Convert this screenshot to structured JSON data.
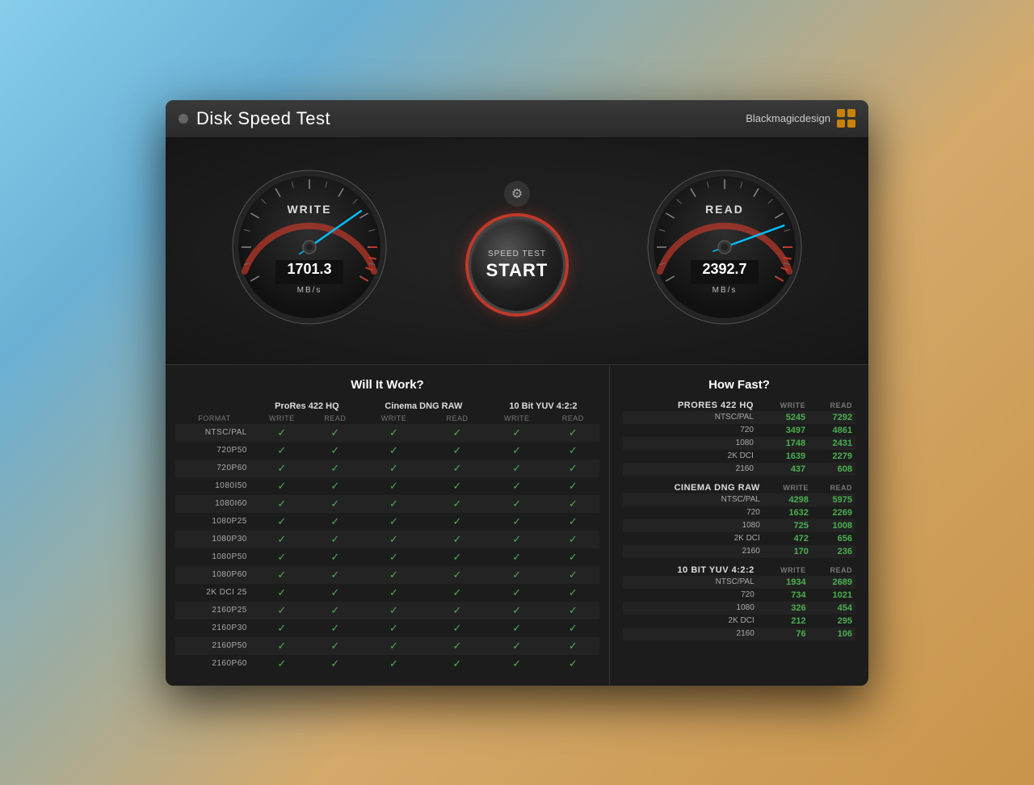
{
  "app": {
    "title": "Disk Speed Test",
    "close_btn": "×",
    "brand_name": "Blackmagicdesign"
  },
  "gauges": {
    "write": {
      "label": "WRITE",
      "value": "1701.3",
      "unit": "MB/s",
      "needle_angle": -20
    },
    "read": {
      "label": "READ",
      "value": "2392.7",
      "unit": "MB/s",
      "needle_angle": 10
    }
  },
  "start_button": {
    "line1": "SPEED TEST",
    "line2": "START"
  },
  "will_it_work": {
    "title": "Will It Work?",
    "column_groups": [
      "ProRes 422 HQ",
      "Cinema DNG RAW",
      "10 Bit YUV 4:2:2"
    ],
    "sub_headers": [
      "WRITE",
      "READ",
      "WRITE",
      "READ",
      "WRITE",
      "READ"
    ],
    "format_header": "FORMAT",
    "rows": [
      {
        "label": "NTSC/PAL",
        "checks": [
          true,
          true,
          true,
          true,
          true,
          true
        ]
      },
      {
        "label": "720p50",
        "checks": [
          true,
          true,
          true,
          true,
          true,
          true
        ]
      },
      {
        "label": "720p60",
        "checks": [
          true,
          true,
          true,
          true,
          true,
          true
        ]
      },
      {
        "label": "1080i50",
        "checks": [
          true,
          true,
          true,
          true,
          true,
          true
        ]
      },
      {
        "label": "1080i60",
        "checks": [
          true,
          true,
          true,
          true,
          true,
          true
        ]
      },
      {
        "label": "1080p25",
        "checks": [
          true,
          true,
          true,
          true,
          true,
          true
        ]
      },
      {
        "label": "1080p30",
        "checks": [
          true,
          true,
          true,
          true,
          true,
          true
        ]
      },
      {
        "label": "1080p50",
        "checks": [
          true,
          true,
          true,
          true,
          true,
          true
        ]
      },
      {
        "label": "1080p60",
        "checks": [
          true,
          true,
          true,
          true,
          true,
          true
        ]
      },
      {
        "label": "2K DCI 25",
        "checks": [
          true,
          true,
          true,
          true,
          true,
          true
        ]
      },
      {
        "label": "2160p25",
        "checks": [
          true,
          true,
          true,
          true,
          true,
          true
        ]
      },
      {
        "label": "2160p30",
        "checks": [
          true,
          true,
          true,
          true,
          true,
          true
        ]
      },
      {
        "label": "2160p50",
        "checks": [
          true,
          true,
          true,
          true,
          true,
          true
        ]
      },
      {
        "label": "2160p60",
        "checks": [
          true,
          true,
          true,
          true,
          true,
          true
        ]
      }
    ]
  },
  "how_fast": {
    "title": "How Fast?",
    "sections": [
      {
        "title": "ProRes 422 HQ",
        "rows": [
          {
            "label": "NTSC/PAL",
            "write": "5245",
            "read": "7292"
          },
          {
            "label": "720",
            "write": "3497",
            "read": "4861"
          },
          {
            "label": "1080",
            "write": "1748",
            "read": "2431"
          },
          {
            "label": "2K DCI",
            "write": "1639",
            "read": "2279"
          },
          {
            "label": "2160",
            "write": "437",
            "read": "608"
          }
        ]
      },
      {
        "title": "Cinema DNG RAW",
        "rows": [
          {
            "label": "NTSC/PAL",
            "write": "4298",
            "read": "5975"
          },
          {
            "label": "720",
            "write": "1632",
            "read": "2269"
          },
          {
            "label": "1080",
            "write": "725",
            "read": "1008"
          },
          {
            "label": "2K DCI",
            "write": "472",
            "read": "656"
          },
          {
            "label": "2160",
            "write": "170",
            "read": "236"
          }
        ]
      },
      {
        "title": "10 Bit YUV 4:2:2",
        "rows": [
          {
            "label": "NTSC/PAL",
            "write": "1934",
            "read": "2689"
          },
          {
            "label": "720",
            "write": "734",
            "read": "1021"
          },
          {
            "label": "1080",
            "write": "326",
            "read": "454"
          },
          {
            "label": "2K DCI",
            "write": "212",
            "read": "295"
          },
          {
            "label": "2160",
            "write": "76",
            "read": "106"
          }
        ]
      }
    ]
  }
}
